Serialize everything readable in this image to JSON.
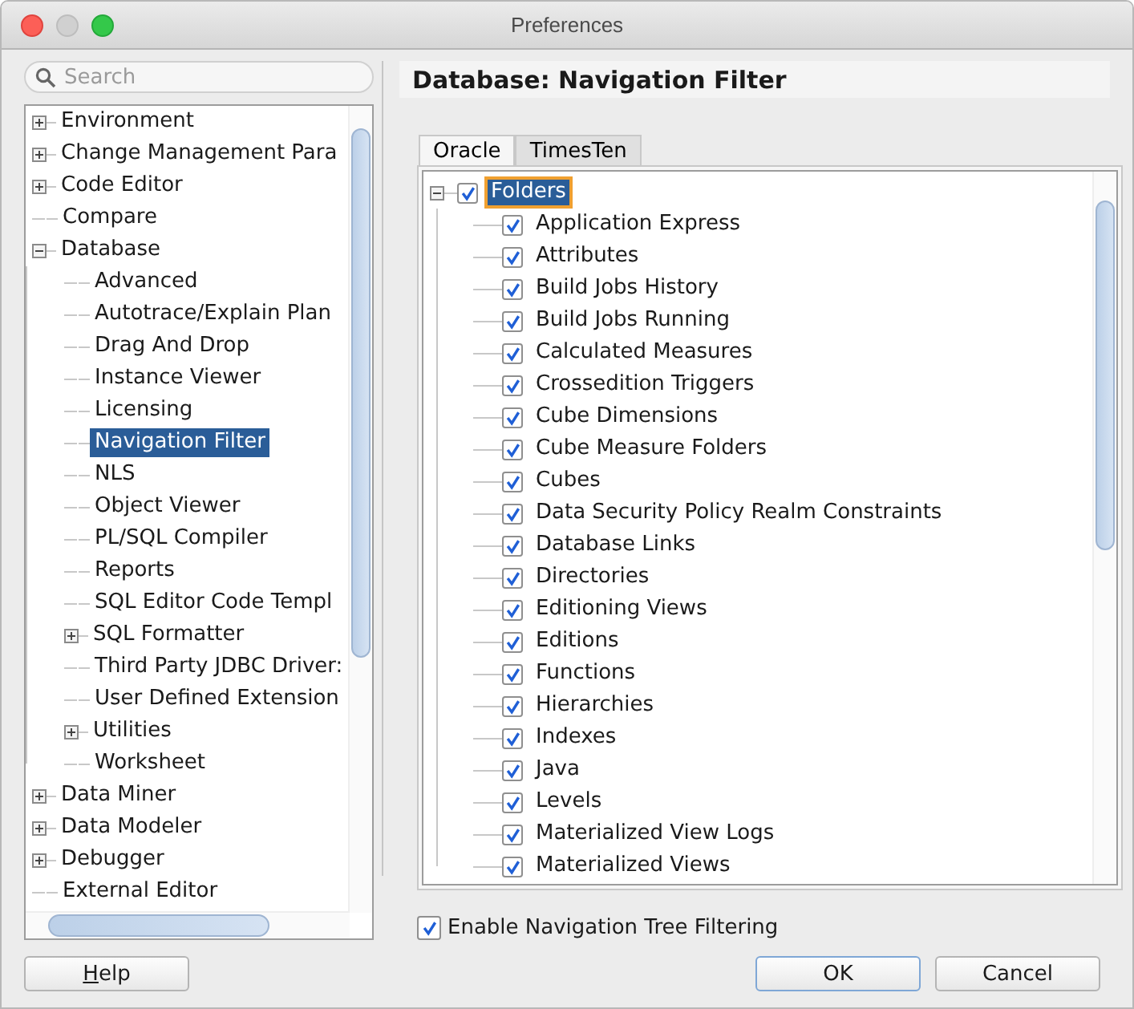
{
  "window": {
    "title": "Preferences"
  },
  "search": {
    "placeholder": "Search"
  },
  "sidebar": {
    "items": [
      {
        "label": "Environment",
        "expanded": false,
        "selected": false
      },
      {
        "label": "Change Management Para",
        "expanded": false,
        "selected": false
      },
      {
        "label": "Code Editor",
        "expanded": false,
        "selected": false
      },
      {
        "label": "Compare",
        "selected": false
      },
      {
        "label": "Database",
        "expanded": true,
        "selected": false,
        "children": [
          {
            "label": "Advanced",
            "selected": false
          },
          {
            "label": "Autotrace/Explain Plan",
            "selected": false
          },
          {
            "label": "Drag And Drop",
            "selected": false
          },
          {
            "label": "Instance Viewer",
            "selected": false
          },
          {
            "label": "Licensing",
            "selected": false
          },
          {
            "label": "Navigation Filter",
            "selected": true
          },
          {
            "label": "NLS",
            "selected": false
          },
          {
            "label": "Object Viewer",
            "selected": false
          },
          {
            "label": "PL/SQL Compiler",
            "selected": false
          },
          {
            "label": "Reports",
            "selected": false
          },
          {
            "label": "SQL Editor Code Templ",
            "selected": false
          },
          {
            "label": "SQL Formatter",
            "expanded": false,
            "selected": false
          },
          {
            "label": "Third Party JDBC Driver:",
            "selected": false
          },
          {
            "label": "User Defined Extension",
            "selected": false
          },
          {
            "label": "Utilities",
            "expanded": false,
            "selected": false
          },
          {
            "label": "Worksheet",
            "selected": false
          }
        ]
      },
      {
        "label": "Data Miner",
        "expanded": false,
        "selected": false
      },
      {
        "label": "Data Modeler",
        "expanded": false,
        "selected": false
      },
      {
        "label": "Debugger",
        "expanded": false,
        "selected": false
      },
      {
        "label": "External Editor",
        "selected": false
      }
    ]
  },
  "page": {
    "title": "Database: Navigation Filter"
  },
  "tabs": [
    {
      "label": "Oracle",
      "selected": true
    },
    {
      "label": "TimesTen",
      "selected": false
    }
  ],
  "filter_tree": {
    "items": [
      {
        "label": "Folders",
        "expanded": true,
        "checked": true,
        "selected": true,
        "children": [
          {
            "label": "Application Express",
            "checked": true,
            "selected": false
          },
          {
            "label": "Attributes",
            "checked": true,
            "selected": false
          },
          {
            "label": "Build Jobs History",
            "checked": true,
            "selected": false
          },
          {
            "label": "Build Jobs Running",
            "checked": true,
            "selected": false
          },
          {
            "label": "Calculated Measures",
            "checked": true,
            "selected": false
          },
          {
            "label": "Crossedition Triggers",
            "checked": true,
            "selected": false
          },
          {
            "label": "Cube Dimensions",
            "checked": true,
            "selected": false
          },
          {
            "label": "Cube Measure Folders",
            "checked": true,
            "selected": false
          },
          {
            "label": "Cubes",
            "checked": true,
            "selected": false
          },
          {
            "label": "Data Security Policy Realm Constraints",
            "checked": true,
            "selected": false
          },
          {
            "label": "Database Links",
            "checked": true,
            "selected": false
          },
          {
            "label": "Directories",
            "checked": true,
            "selected": false
          },
          {
            "label": "Editioning Views",
            "checked": true,
            "selected": false
          },
          {
            "label": "Editions",
            "checked": true,
            "selected": false
          },
          {
            "label": "Functions",
            "checked": true,
            "selected": false
          },
          {
            "label": "Hierarchies",
            "checked": true,
            "selected": false
          },
          {
            "label": "Indexes",
            "checked": true,
            "selected": false
          },
          {
            "label": "Java",
            "checked": true,
            "selected": false
          },
          {
            "label": "Levels",
            "checked": true,
            "selected": false
          },
          {
            "label": "Materialized View Logs",
            "checked": true,
            "selected": false
          },
          {
            "label": "Materialized Views",
            "checked": true,
            "selected": false
          }
        ]
      }
    ]
  },
  "enable_filtering": {
    "label": "Enable Navigation Tree Filtering",
    "checked": true
  },
  "buttons": [
    {
      "label": "Help",
      "mnemonic": true,
      "default": false
    },
    {
      "label": "OK",
      "default": true
    },
    {
      "label": "Cancel",
      "default": false
    }
  ]
}
